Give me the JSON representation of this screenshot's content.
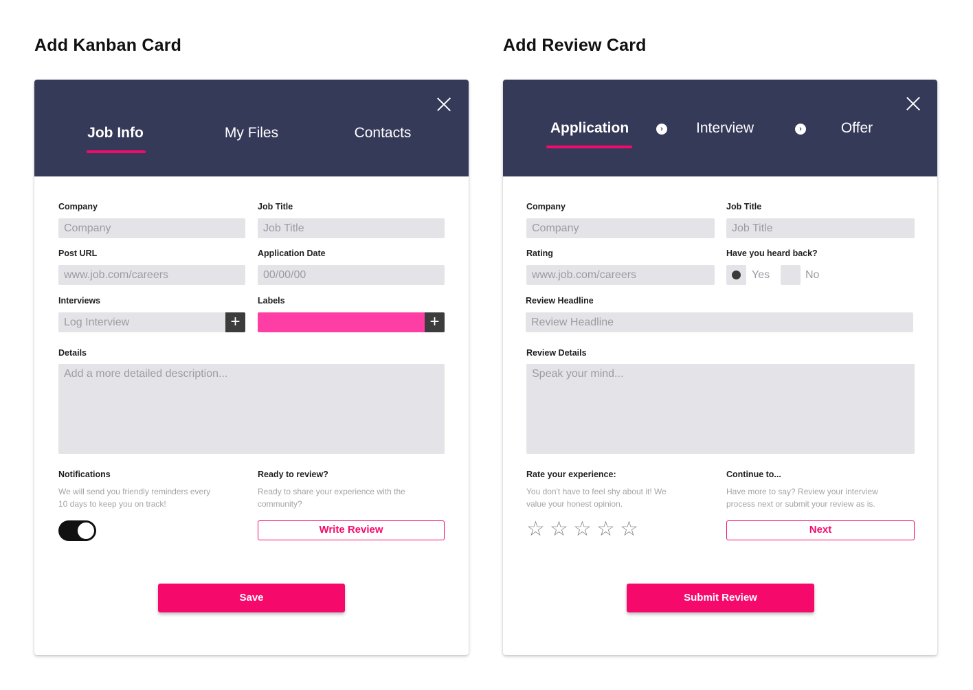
{
  "left_section_title": "Add Kanban Card",
  "right_section_title": "Add Review Card",
  "kanban": {
    "tabs": [
      "Job Info",
      "My Files",
      "Contacts"
    ],
    "company_label": "Company",
    "company_placeholder": "Company",
    "job_title_label": "Job Title",
    "job_title_placeholder": "Job Title",
    "post_url_label": "Post URL",
    "post_url_placeholder": "www.job.com/careers",
    "application_date_label": "Application Date",
    "application_date_placeholder": "00/00/00",
    "interviews_label": "Interviews",
    "interviews_placeholder": "Log Interview",
    "labels_label": "Labels",
    "label_color": "#ff3ea5",
    "details_label": "Details",
    "details_placeholder": "Add a more detailed description...",
    "notifications_label": "Notifications",
    "notifications_desc": "We will send you friendly reminders every 10 days to keep you on track!",
    "notifications_enabled": true,
    "ready_label": "Ready to review?",
    "ready_desc": "Ready to share your experience with the community?",
    "write_review_button": "Write Review",
    "save_button": "Save"
  },
  "review": {
    "steps": [
      "Application",
      "Interview",
      "Offer"
    ],
    "company_label": "Company",
    "company_placeholder": "Company",
    "job_title_label": "Job Title",
    "job_title_placeholder": "Job Title",
    "rating_label": "Rating",
    "rating_placeholder": "www.job.com/careers",
    "heard_back_label": "Have you heard back?",
    "yes_label": "Yes",
    "no_label": "No",
    "heard_back_selected": "Yes",
    "headline_label": "Review Headline",
    "headline_placeholder": "Review Headline",
    "details_label": "Review Details",
    "details_placeholder": "Speak your mind...",
    "rate_label": "Rate your experience:",
    "rate_desc": "You don't have to feel shy about it! We value your honest opinion.",
    "star_rating": 0,
    "stars_max": 5,
    "continue_label": "Continue to...",
    "continue_desc": "Have more to say? Review your interview process next or submit your review as is.",
    "next_button": "Next",
    "submit_button": "Submit Review"
  },
  "colors": {
    "header_bg": "#363a59",
    "accent": "#f50a6b",
    "field_bg": "#e4e4e8"
  },
  "icons": [
    "close-icon",
    "plus-icon",
    "chevron-right-icon",
    "star-outline-icon"
  ]
}
